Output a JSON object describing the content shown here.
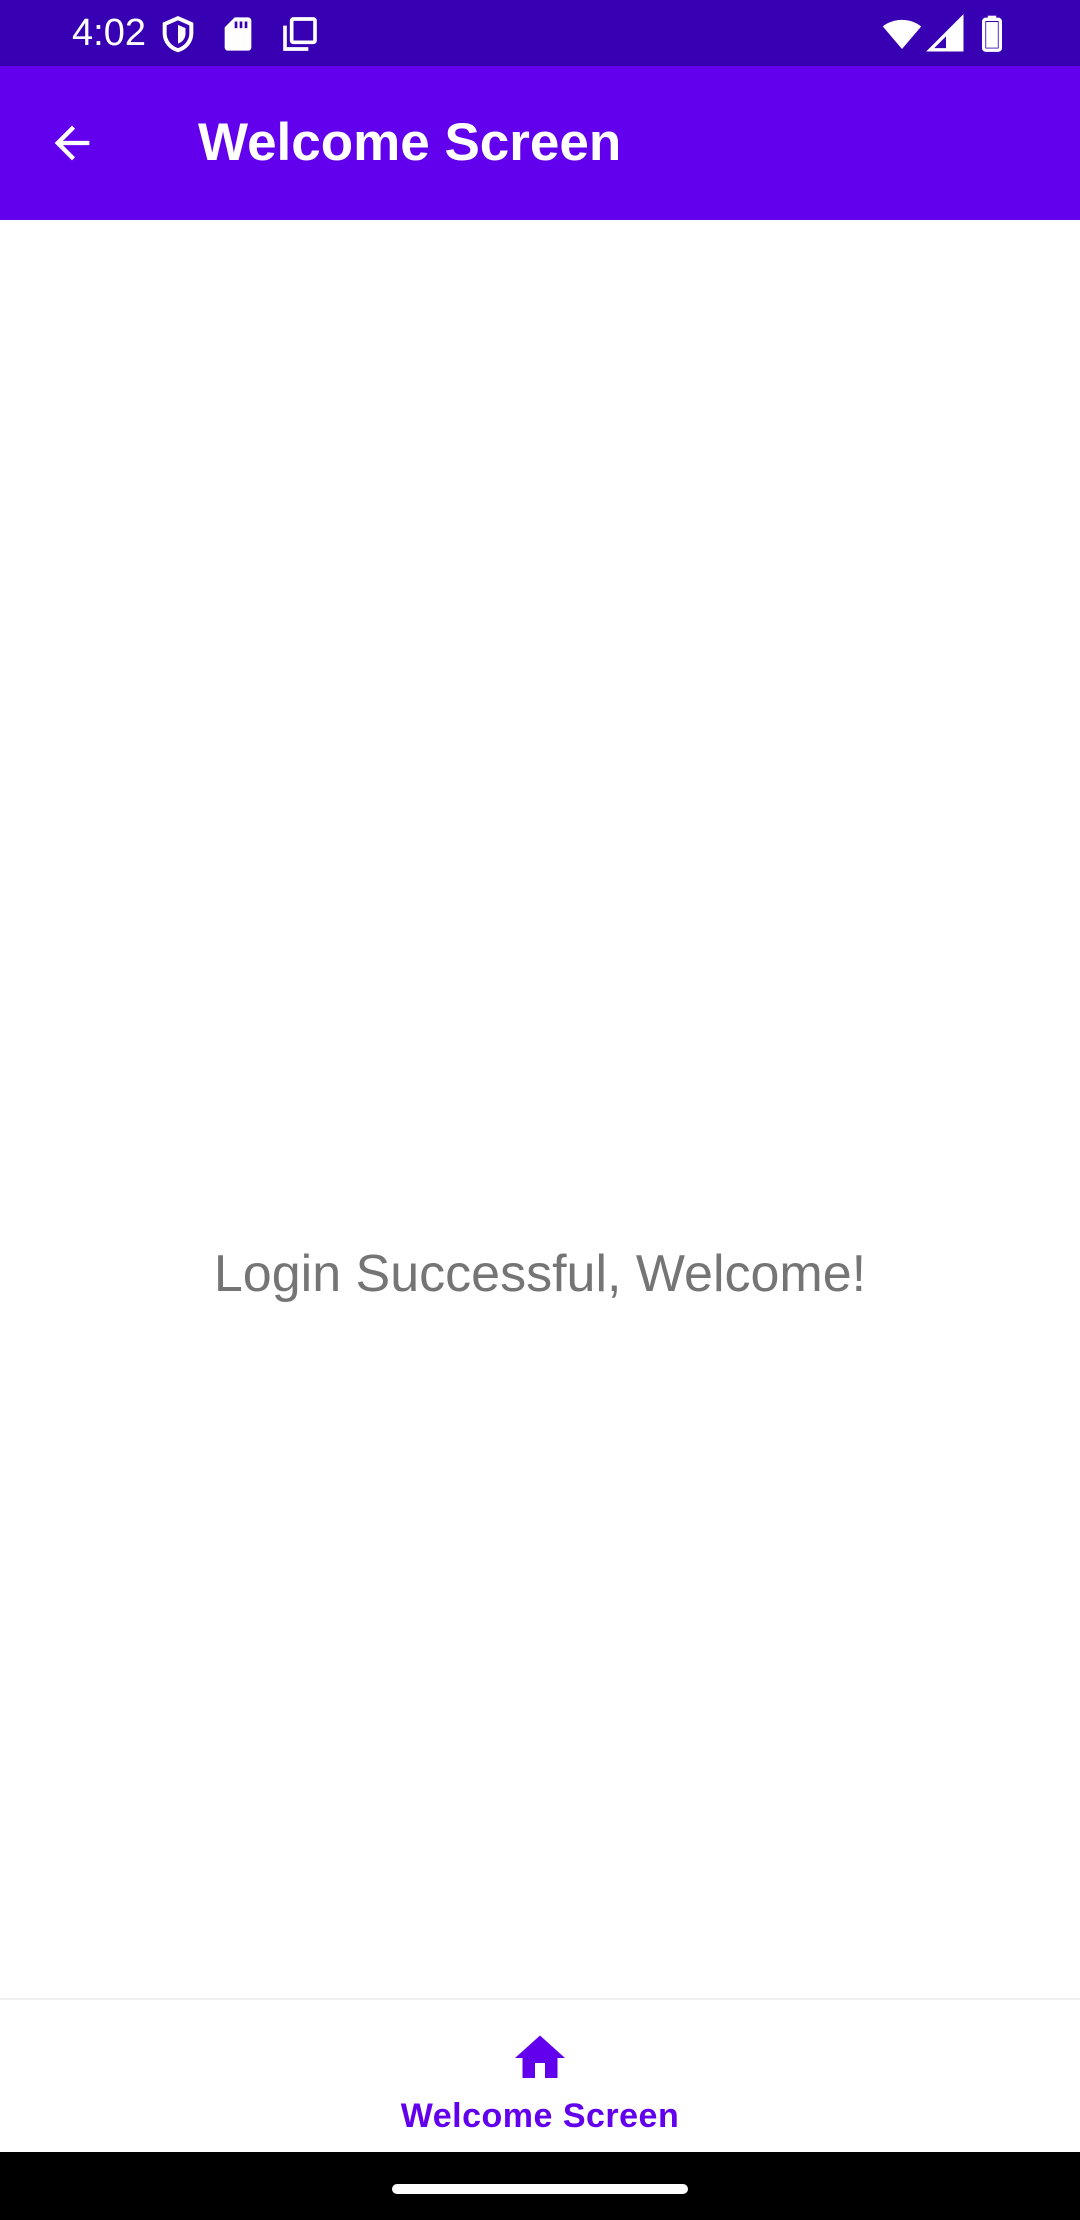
{
  "status_bar": {
    "time": "4:02",
    "icons": [
      "shield-icon",
      "sd-card-icon",
      "copy-icon",
      "wifi-icon",
      "cell-signal-icon",
      "battery-icon"
    ]
  },
  "app_bar": {
    "title": "Welcome Screen",
    "back_icon": "arrow-back-icon",
    "color": "#6200ee"
  },
  "main": {
    "message": "Login Successful, Welcome!"
  },
  "bottom_nav": {
    "items": [
      {
        "label": "Welcome Screen",
        "icon": "home-icon",
        "selected": true
      }
    ],
    "active_color": "#6200ee"
  },
  "colors": {
    "status_bar": "#3700b3",
    "primary": "#6200ee",
    "message_text": "#757575"
  }
}
